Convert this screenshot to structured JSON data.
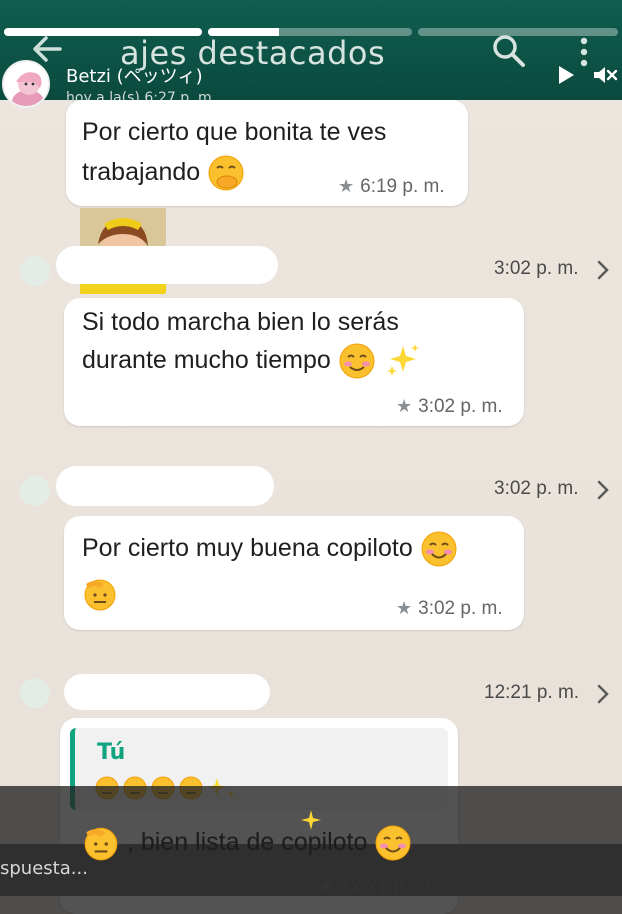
{
  "header": {
    "title": "ajes destacados",
    "story_name": "Betzi (ペッツィ)",
    "story_time": "hoy a la(s) 6:27 p. m.",
    "progress": [
      1.0,
      0.35,
      0.0
    ]
  },
  "messages": [
    {
      "text_line1": "Por cierto que bonita te ves",
      "text_line2": "trabajando",
      "time": "6:19 p. m."
    },
    {
      "head_time": "3:02 p. m.",
      "text_line1": "Si todo marcha bien lo serás",
      "text_line2": "durante mucho tiempo",
      "time": "3:02 p. m."
    },
    {
      "head_time": "3:02 p. m.",
      "text_line1": "Por cierto  muy buena copiloto",
      "time": "3:02 p. m."
    },
    {
      "head_time": "12:21 p. m.",
      "quote_author": "Tú",
      "text_line1": ", bien lista de copiloto",
      "time": "12:21 p. m."
    }
  ],
  "reply": {
    "placeholder": "spuesta..."
  },
  "colors": {
    "header": "#0b4a3e",
    "accent": "#0fa37f",
    "bubble": "#ffffff",
    "background": "#e8e1d9"
  }
}
